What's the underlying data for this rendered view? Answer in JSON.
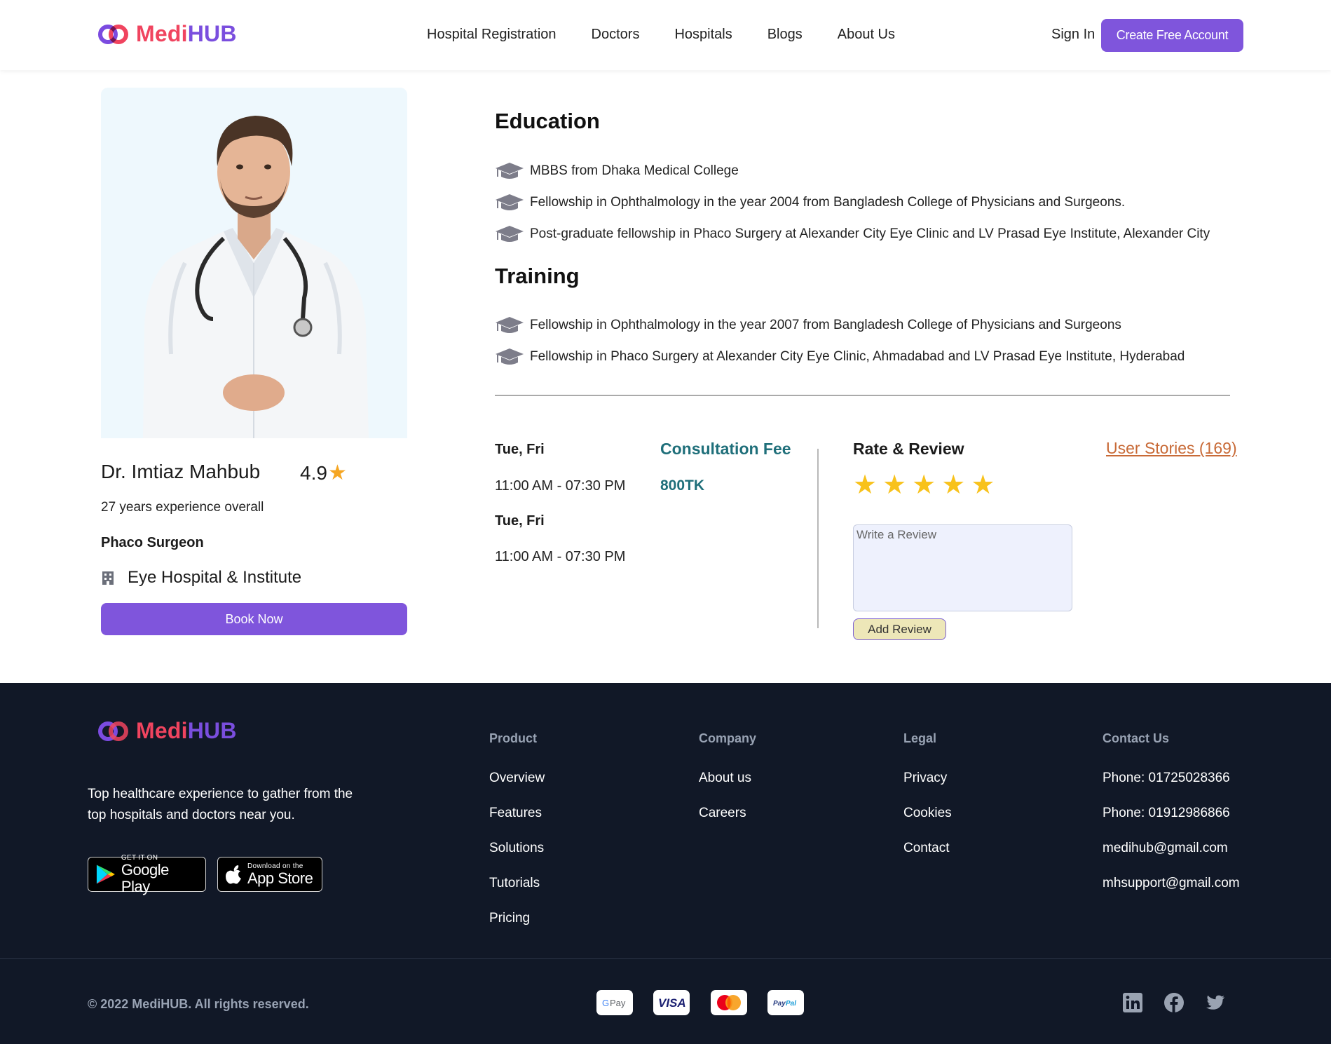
{
  "brand": {
    "medi": "Medi",
    "hub": "HUB"
  },
  "nav": {
    "items": [
      "Hospital Registration",
      "Doctors",
      "Hospitals",
      "Blogs",
      "About Us"
    ],
    "sign_in": "Sign In",
    "create_account": "Create Free Account"
  },
  "doctor": {
    "name": "Dr. Imtiaz Mahbub",
    "rating": "4.9",
    "experience": "27 years experience overall",
    "specialty": "Phaco Surgeon",
    "hospital": "Eye Hospital & Institute",
    "book_label": "Book Now"
  },
  "education": {
    "title": "Education",
    "items": [
      "MBBS from Dhaka Medical College",
      "Fellowship in Ophthalmology in the year 2004 from Bangladesh College of Physicians and Surgeons.",
      "Post-graduate fellowship in Phaco Surgery at Alexander City Eye Clinic and LV Prasad Eye Institute, Alexander City"
    ]
  },
  "training": {
    "title": "Training",
    "items": [
      "Fellowship in Ophthalmology in the year 2007 from Bangladesh College of Physicians and Surgeons",
      "Fellowship in Phaco Surgery at Alexander City Eye Clinic, Ahmadabad and LV Prasad Eye Institute, Hyderabad"
    ]
  },
  "schedule": [
    {
      "days": "Tue, Fri",
      "time": "11:00 AM - 07:30 PM"
    },
    {
      "days": "Tue, Fri",
      "time": "11:00 AM - 07:30 PM"
    }
  ],
  "fee": {
    "label": "Consultation Fee",
    "value": "800TK"
  },
  "review": {
    "title": "Rate & Review",
    "stories": "User Stories (169)",
    "stars": 5,
    "placeholder": "Write a Review",
    "add_label": "Add Review"
  },
  "footer": {
    "description": "Top healthcare experience to gather from the top hospitals and doctors near you.",
    "google_play": {
      "small": "GET IT ON",
      "big": "Google Play"
    },
    "app_store": {
      "small": "Download on the",
      "big": "App Store"
    },
    "columns": [
      {
        "title": "Product",
        "links": [
          "Overview",
          "Features",
          "Solutions",
          "Tutorials",
          "Pricing"
        ]
      },
      {
        "title": "Company",
        "links": [
          "About us",
          "Careers"
        ]
      },
      {
        "title": "Legal",
        "links": [
          "Privacy",
          "Cookies",
          "Contact"
        ]
      },
      {
        "title": "Contact Us",
        "links": [
          "Phone: 01725028366",
          "Phone: 01912986866",
          "medihub@gmail.com",
          "mhsupport@gmail.com"
        ]
      }
    ],
    "copyright": "© 2022 MediHUB. All rights reserved.",
    "payments": [
      "gpay-icon",
      "visa-icon",
      "mastercard-icon",
      "paypal-icon"
    ],
    "social": [
      "linkedin-icon",
      "facebook-icon",
      "twitter-icon"
    ]
  },
  "colors": {
    "accent": "#7f55dc",
    "brand_red": "#f0445f",
    "footer_bg": "#111827",
    "fee": "#1f6f7a",
    "star": "#f8c21b"
  }
}
